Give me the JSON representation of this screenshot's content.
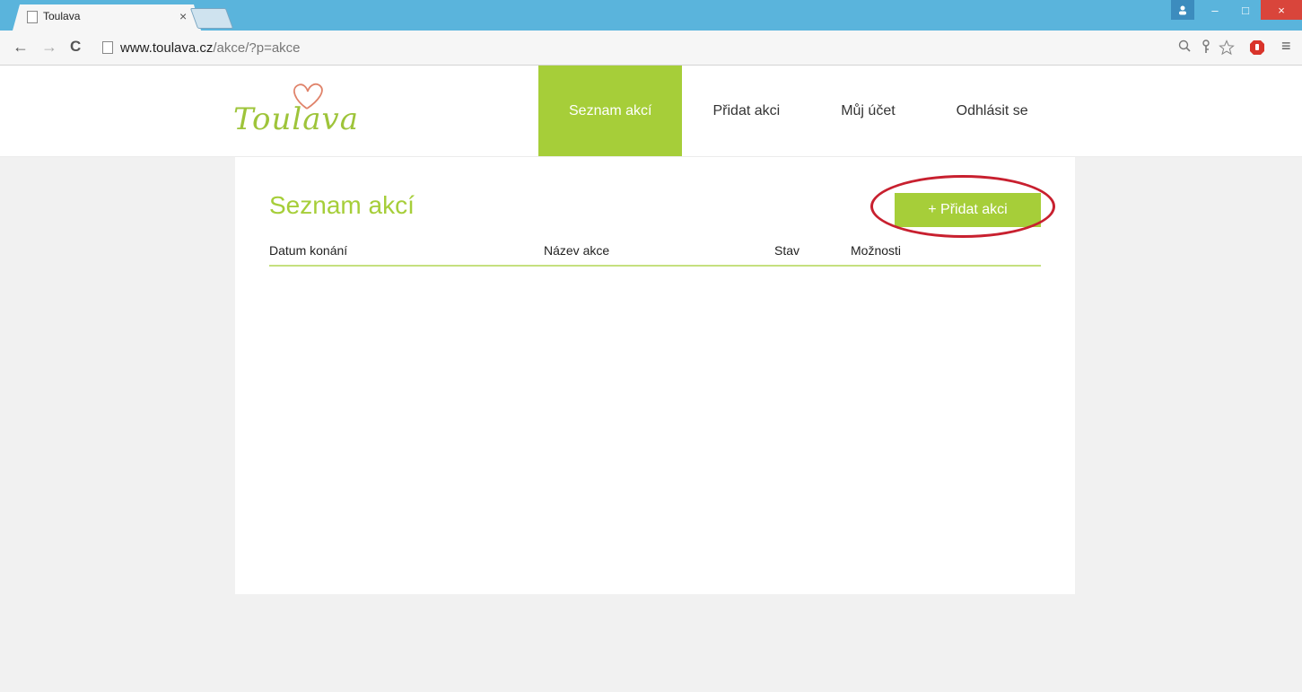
{
  "browser": {
    "tab_title": "Toulava",
    "tab_close": "×",
    "url_domain": "www.toulava.cz",
    "url_path": "/akce/?p=akce",
    "buttons": {
      "back": "←",
      "forward": "→",
      "reload": "C",
      "minimize": "–",
      "maximize": "□",
      "close": "×",
      "menu": "≡"
    }
  },
  "site": {
    "logo_text": "Toulava",
    "nav": [
      {
        "label": "Seznam akcí",
        "active": true
      },
      {
        "label": "Přidat akci",
        "active": false
      },
      {
        "label": "Můj účet",
        "active": false
      },
      {
        "label": "Odhlásit se",
        "active": false
      }
    ]
  },
  "main": {
    "title": "Seznam akcí",
    "add_button": "+ Přidat akci",
    "columns": [
      "Datum konání",
      "Název akce",
      "Stav",
      "Možnosti"
    ]
  },
  "colors": {
    "accent": "#a6ce39",
    "highlight": "#c8202f",
    "logo_heart": "#e0836a"
  }
}
